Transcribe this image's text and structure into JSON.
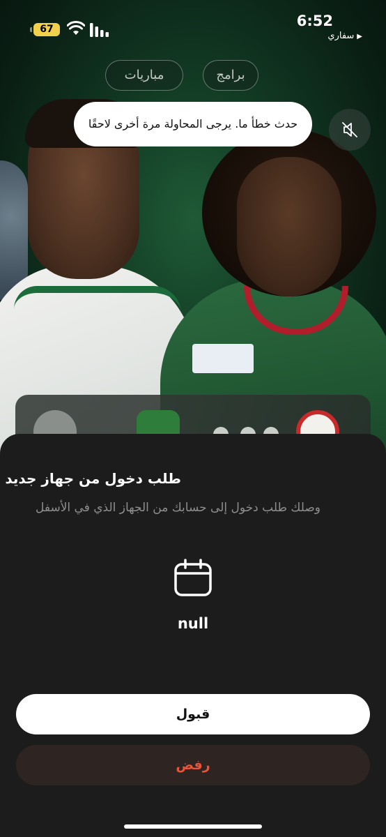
{
  "status_bar": {
    "time": "6:52",
    "battery_level": "67",
    "back_app": "سفاري",
    "back_arrow": "▶"
  },
  "tabs": [
    {
      "label": "مباريات"
    },
    {
      "label": "برامج"
    }
  ],
  "toast": {
    "message": "حدث خطأ ما. يرجى المحاولة مرة أخرى لاحقًا"
  },
  "mute_button": {
    "icon": "speaker-muted-icon"
  },
  "sheet": {
    "title": "طلب دخول من جهاز جديد",
    "subtitle": "وصلك طلب دخول إلى حسابك من الجهاز الذي في الأسفل",
    "device_icon": "calendar-icon",
    "device_name": "null",
    "accept_label": "قبول",
    "reject_label": "رفض"
  },
  "colors": {
    "sheet_bg": "#1c1c1c",
    "reject_text": "#e8543a",
    "battery": "#f1d14b"
  }
}
